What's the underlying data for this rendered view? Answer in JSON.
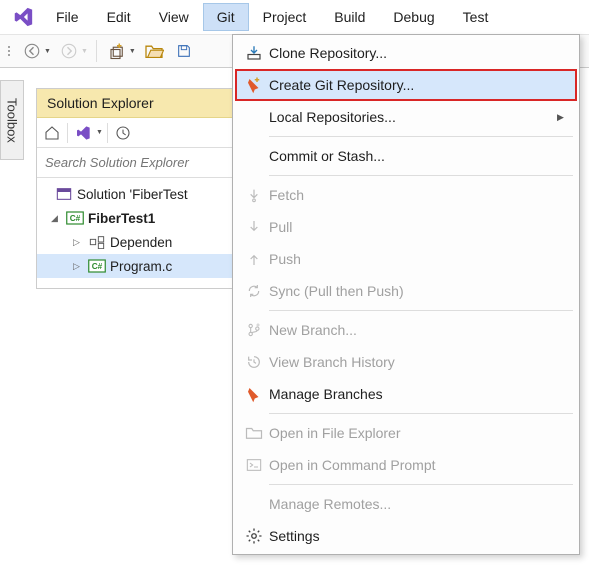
{
  "menubar": {
    "items": [
      "File",
      "Edit",
      "View",
      "Git",
      "Project",
      "Build",
      "Debug",
      "Test"
    ],
    "active_index": 3
  },
  "toolbox_tab": "Toolbox",
  "solution_explorer": {
    "title": "Solution Explorer",
    "search_placeholder": "Search Solution Explorer",
    "nodes": {
      "solution": "Solution 'FiberTest",
      "project": "FiberTest1",
      "dep": "Dependen",
      "program": "Program.c"
    }
  },
  "git_menu": {
    "clone": "Clone Repository...",
    "create": "Create Git Repository...",
    "local": "Local Repositories...",
    "commit": "Commit or Stash...",
    "fetch": "Fetch",
    "pull": "Pull",
    "push": "Push",
    "sync": "Sync (Pull then Push)",
    "newbranch": "New Branch...",
    "history": "View Branch History",
    "manage": "Manage Branches",
    "openfe": "Open in File Explorer",
    "opencmd": "Open in Command Prompt",
    "remotes": "Manage Remotes...",
    "settings": "Settings"
  }
}
